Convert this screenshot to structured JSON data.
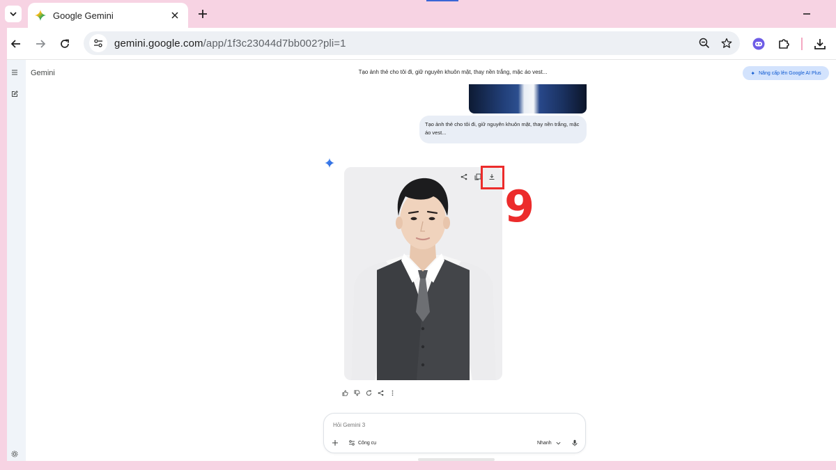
{
  "browser": {
    "tab_title": "Google Gemini",
    "url_domain": "gemini.google.com",
    "url_path": "/app/1f3c23044d7bb002?pli=1"
  },
  "page": {
    "brand": "Gemini",
    "conversation_title": "Tạo ảnh thẻ cho tôi đi, giữ nguyên khuôn mặt, thay nền trắng, mặc áo vest...",
    "upgrade_label": "Nâng cấp lên Google AI Plus",
    "user_message": "Tạo ảnh thẻ cho tôi đi, giữ nguyên khuôn mặt, thay nền trắng, mặc áo vest...",
    "step_number": "9",
    "input_placeholder": "Hỏi Gemini 3",
    "tools_label": "Công cụ",
    "mode_label": "Nhanh"
  },
  "colors": {
    "frame": "#f7d3e3",
    "highlight": "#ec2b2b",
    "accent": "#0b57d0"
  }
}
